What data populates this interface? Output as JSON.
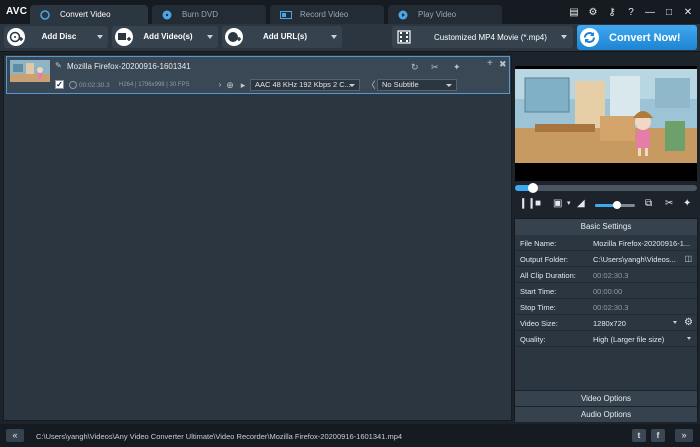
{
  "app": {
    "logo": "AVC"
  },
  "tabs": [
    {
      "label": "Convert Video",
      "icon": "convert-icon",
      "active": true
    },
    {
      "label": "Burn DVD",
      "icon": "disc-icon",
      "active": false
    },
    {
      "label": "Record Video",
      "icon": "record-icon",
      "active": false
    },
    {
      "label": "Play Video",
      "icon": "play-icon",
      "active": false
    }
  ],
  "toolbar": {
    "add_disc": "Add Disc",
    "add_videos": "Add Video(s)",
    "add_urls": "Add URL(s)",
    "output_format": "Customized MP4 Movie (*.mp4)",
    "convert_now": "Convert Now!"
  },
  "file_item": {
    "name": "Mozilla Firefox-20200916-1601341",
    "duration": "00:02:30.3",
    "meta": "H264 | 1796x998 | 30 FPS",
    "audio_track": "AAC 48 KHz 192 Kbps 2 C...",
    "subtitle": "No Subtitle",
    "checked": true
  },
  "player": {
    "progress": 0.1,
    "volume": 0.55
  },
  "settings": {
    "title": "Basic Settings",
    "rows": [
      {
        "key": "File Name:",
        "value": "Mozilla Firefox-20200916-1...",
        "dim": false,
        "dropdown": false
      },
      {
        "key": "Output Folder:",
        "value": "C:\\Users\\yangh\\Videos...",
        "dim": false,
        "dropdown": false,
        "folder": true
      },
      {
        "key": "All Clip Duration:",
        "value": "00:02:30.3",
        "dim": true,
        "dropdown": false
      },
      {
        "key": "Start Time:",
        "value": "00:00:00",
        "dim": true,
        "dropdown": false
      },
      {
        "key": "Stop Time:",
        "value": "00:02:30.3",
        "dim": true,
        "dropdown": false
      },
      {
        "key": "Video Size:",
        "value": "1280x720",
        "dim": false,
        "dropdown": true,
        "gear": true
      },
      {
        "key": "Quality:",
        "value": "High (Larger file size)",
        "dim": false,
        "dropdown": true
      }
    ],
    "video_options": "Video Options",
    "audio_options": "Audio Options"
  },
  "statusbar": {
    "path": "C:\\Users\\yangh\\Videos\\Any Video Converter Ultimate\\Video Recorder\\Mozilla Firefox-20200916-1601341.mp4",
    "twitter": "t",
    "facebook": "f"
  },
  "colors": {
    "accent": "#3fa9f0",
    "background": "#2b3641",
    "selection_border": "#4f9ad3"
  }
}
